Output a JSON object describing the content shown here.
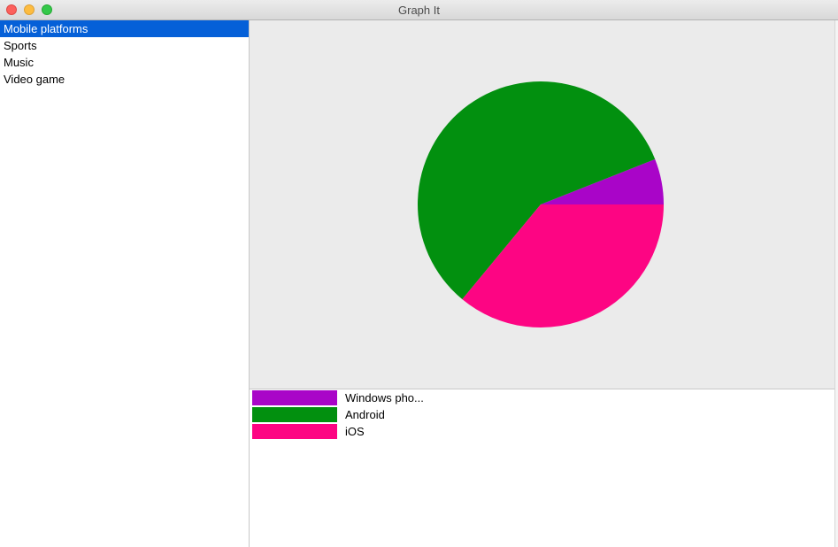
{
  "window": {
    "title": "Graph It"
  },
  "sidebar": {
    "items": [
      {
        "label": "Mobile platforms",
        "selected": true
      },
      {
        "label": "Sports",
        "selected": false
      },
      {
        "label": "Music",
        "selected": false
      },
      {
        "label": "Video game",
        "selected": false
      }
    ]
  },
  "chart_data": {
    "type": "pie",
    "categories": [
      "Windows pho...",
      "Android",
      "iOS"
    ],
    "values": [
      6,
      58,
      36
    ],
    "colors": [
      "#a905c8",
      "#02900f",
      "#fd0583"
    ],
    "start_angle_deg": 0,
    "direction": "counterclockwise"
  },
  "legend": {
    "items": [
      {
        "label": "Windows pho...",
        "color": "#a905c8"
      },
      {
        "label": "Android",
        "color": "#02900f"
      },
      {
        "label": "iOS",
        "color": "#fd0583"
      }
    ]
  }
}
